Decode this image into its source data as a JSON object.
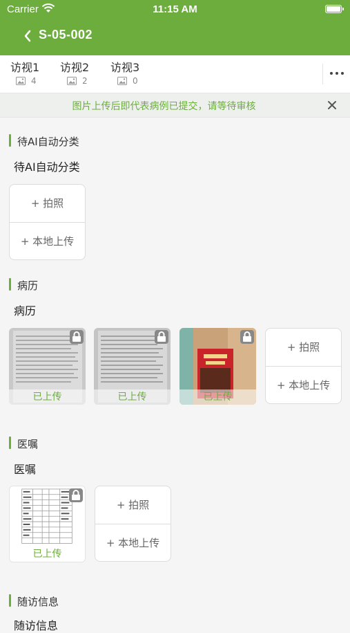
{
  "status_bar": {
    "carrier": "Carrier",
    "time": "11:15 AM"
  },
  "nav": {
    "title": "S-05-002",
    "back_icon": "chevron-left-icon"
  },
  "tabs": [
    {
      "label": "访视1",
      "count": "4"
    },
    {
      "label": "访视2",
      "count": "2"
    },
    {
      "label": "访视3",
      "count": "0"
    }
  ],
  "notice": {
    "text": "图片上传后即代表病例已提交，请等待审核"
  },
  "upload": {
    "photo_label": "+ 拍照",
    "local_label": "+ 本地上传"
  },
  "sections": [
    {
      "name": "待AI自动分类",
      "subtitle": "待AI自动分类",
      "images": []
    },
    {
      "name": "病历",
      "subtitle": "病历",
      "images": [
        {
          "status": "已上传"
        },
        {
          "status": "已上传"
        },
        {
          "status": "已上传"
        }
      ]
    },
    {
      "name": "医嘱",
      "subtitle": "医嘱",
      "images": [
        {
          "status": "已上传"
        }
      ]
    },
    {
      "name": "随访信息",
      "subtitle": "随访信息",
      "images": []
    }
  ],
  "colors": {
    "brand": "#6cad3e",
    "background": "#f5f5f5"
  }
}
